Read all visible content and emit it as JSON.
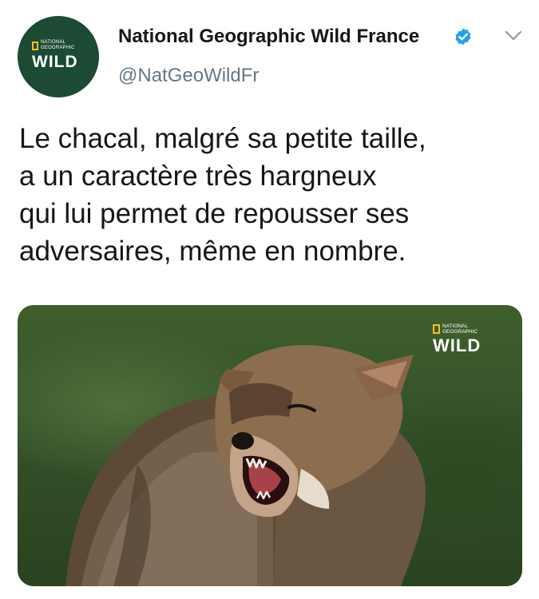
{
  "account": {
    "name": "National Geographic Wild France",
    "handle": "@NatGeoWildFr",
    "avatar_logo": {
      "line1": "NATIONAL",
      "line2": "GEOGRAPHIC",
      "wordmark": "WILD"
    },
    "verified": true
  },
  "tweet": {
    "text_lines": [
      "Le chacal, malgré sa petite taille,",
      "a un caractère très hargneux",
      "qui lui permet de repousser ses",
      "adversaires, même en nombre."
    ]
  },
  "media": {
    "type": "video",
    "subject": "jackal snarling",
    "watermark": {
      "line1": "NATIONAL",
      "line2": "GEOGRAPHIC",
      "wordmark": "WILD"
    }
  },
  "colors": {
    "brand_green": "#1c4a33",
    "brand_yellow": "#f3c31a",
    "verified_blue": "#1da1f2",
    "text_primary": "#14171a",
    "text_secondary": "#657786"
  },
  "icons": {
    "verified": "verified-badge-icon",
    "menu": "chevron-down-icon"
  }
}
